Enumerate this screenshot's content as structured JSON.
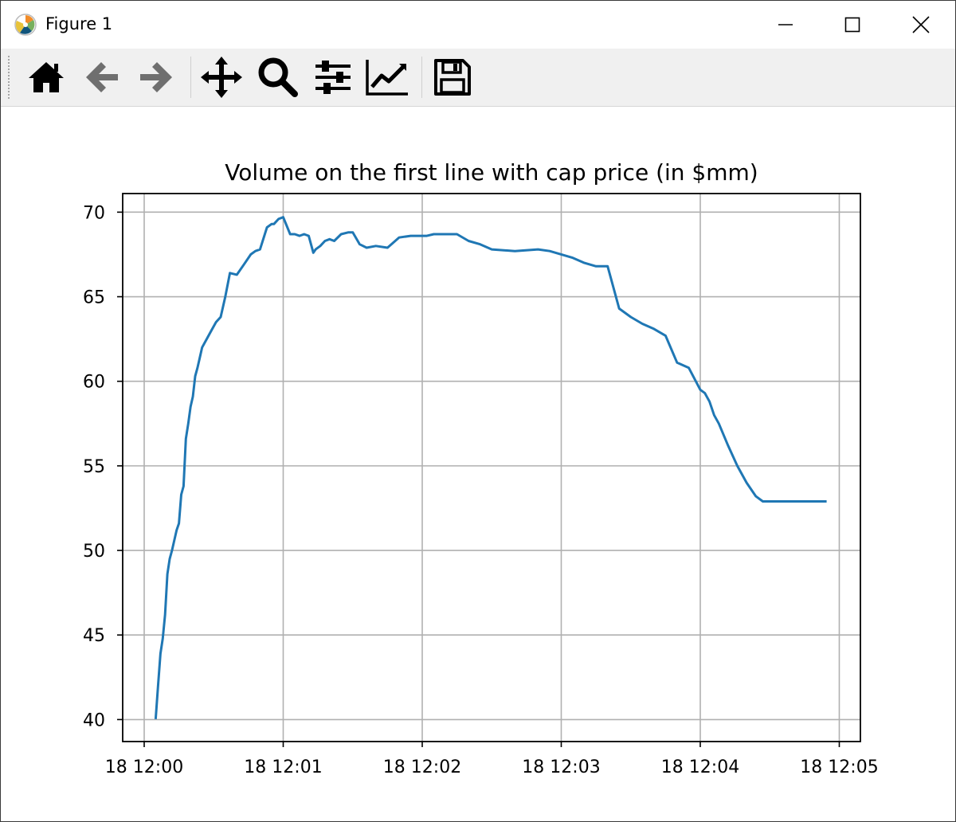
{
  "window": {
    "title": "Figure 1",
    "controls": [
      "minimize",
      "maximize",
      "close"
    ]
  },
  "toolbar": {
    "tools": [
      {
        "name": "home-icon",
        "tooltip": "Home"
      },
      {
        "name": "back-icon",
        "tooltip": "Back"
      },
      {
        "name": "forward-icon",
        "tooltip": "Forward"
      },
      {
        "name": "pan-icon",
        "tooltip": "Pan"
      },
      {
        "name": "zoom-icon",
        "tooltip": "Zoom"
      },
      {
        "name": "subplots-icon",
        "tooltip": "Configure subplots"
      },
      {
        "name": "edit-axis-icon",
        "tooltip": "Edit axis"
      },
      {
        "name": "save-icon",
        "tooltip": "Save"
      }
    ]
  },
  "chart_data": {
    "type": "line",
    "title": "Volume on the first line with cap price (in $mm)",
    "xlabel": "",
    "ylabel": "",
    "xlim": [
      "12:00:00",
      "12:05:00"
    ],
    "ylim": [
      38.7,
      71.1
    ],
    "xticks": [
      "18 12:00",
      "18 12:01",
      "18 12:02",
      "18 12:03",
      "18 12:04",
      "18 12:05"
    ],
    "yticks": [
      "40",
      "45",
      "50",
      "55",
      "60",
      "65",
      "70"
    ],
    "grid": true,
    "color": "#1f77b4",
    "series": [
      {
        "x": [
          "12:00:05",
          "12:00:06",
          "12:00:07",
          "12:00:08",
          "12:00:09",
          "12:00:10",
          "12:00:11",
          "12:00:12",
          "12:00:13",
          "12:00:14",
          "12:00:15",
          "12:00:16",
          "12:00:17",
          "12:00:18",
          "12:00:19",
          "12:00:20",
          "12:00:21",
          "12:00:22",
          "12:00:23",
          "12:00:24",
          "12:00:25",
          "12:00:27",
          "12:00:29",
          "12:00:31",
          "12:00:33",
          "12:00:35",
          "12:00:37",
          "12:00:40",
          "12:00:43",
          "12:00:46",
          "12:00:48",
          "12:00:50",
          "12:00:53",
          "12:00:55",
          "12:00:56",
          "12:00:58",
          "12:01:00",
          "12:01:03",
          "12:01:05",
          "12:01:07",
          "12:01:09",
          "12:01:11",
          "12:01:13",
          "12:01:14",
          "12:01:16",
          "12:01:18",
          "12:01:20",
          "12:01:22",
          "12:01:25",
          "12:01:28",
          "12:01:30",
          "12:01:33",
          "12:01:36",
          "12:01:40",
          "12:01:45",
          "12:01:50",
          "12:01:55",
          "12:01:58",
          "12:02:00",
          "12:02:02",
          "12:02:05",
          "12:02:10",
          "12:02:15",
          "12:02:20",
          "12:02:25",
          "12:02:30",
          "12:02:40",
          "12:02:50",
          "12:02:55",
          "12:03:00",
          "12:03:05",
          "12:03:10",
          "12:03:15",
          "12:03:20",
          "12:03:25",
          "12:03:30",
          "12:03:35",
          "12:03:40",
          "12:03:45",
          "12:03:50",
          "12:03:55",
          "12:04:00",
          "12:04:02",
          "12:04:04",
          "12:04:06",
          "12:04:08",
          "12:04:12",
          "12:04:16",
          "12:04:20",
          "12:04:24",
          "12:04:27",
          "12:04:30",
          "12:04:32",
          "12:04:34",
          "12:04:36",
          "12:04:38",
          "12:04:40",
          "12:04:42",
          "12:04:44",
          "12:04:46",
          "12:04:48",
          "12:04:50",
          "12:04:52",
          "12:04:54"
        ],
        "y": [
          40.1,
          42.0,
          43.9,
          44.8,
          46.2,
          48.6,
          49.5,
          50.0,
          50.6,
          51.2,
          51.6,
          53.3,
          53.8,
          56.6,
          57.5,
          58.5,
          59.1,
          60.3,
          60.8,
          61.4,
          62.0,
          62.5,
          63.0,
          63.5,
          63.8,
          65.0,
          66.4,
          66.3,
          66.9,
          67.5,
          67.7,
          67.8,
          69.1,
          69.3,
          69.3,
          69.6,
          69.7,
          68.7,
          68.7,
          68.6,
          68.7,
          68.6,
          67.6,
          67.8,
          68.0,
          68.3,
          68.4,
          68.3,
          68.7,
          68.8,
          68.8,
          68.1,
          67.9,
          68.0,
          67.9,
          68.5,
          68.6,
          68.6,
          68.6,
          68.6,
          68.7,
          68.7,
          68.7,
          68.3,
          68.1,
          67.8,
          67.7,
          67.8,
          67.7,
          67.5,
          67.3,
          67.0,
          66.8,
          66.8,
          64.3,
          63.8,
          63.4,
          63.1,
          62.7,
          61.1,
          60.8,
          59.5,
          59.3,
          58.8,
          58.0,
          57.5,
          56.2,
          55.0,
          54.0,
          53.2,
          52.9,
          52.9,
          52.9,
          52.9,
          52.9,
          52.9,
          52.9,
          52.9,
          52.9,
          52.9,
          52.9,
          52.9,
          52.9,
          52.9
        ]
      }
    ]
  }
}
